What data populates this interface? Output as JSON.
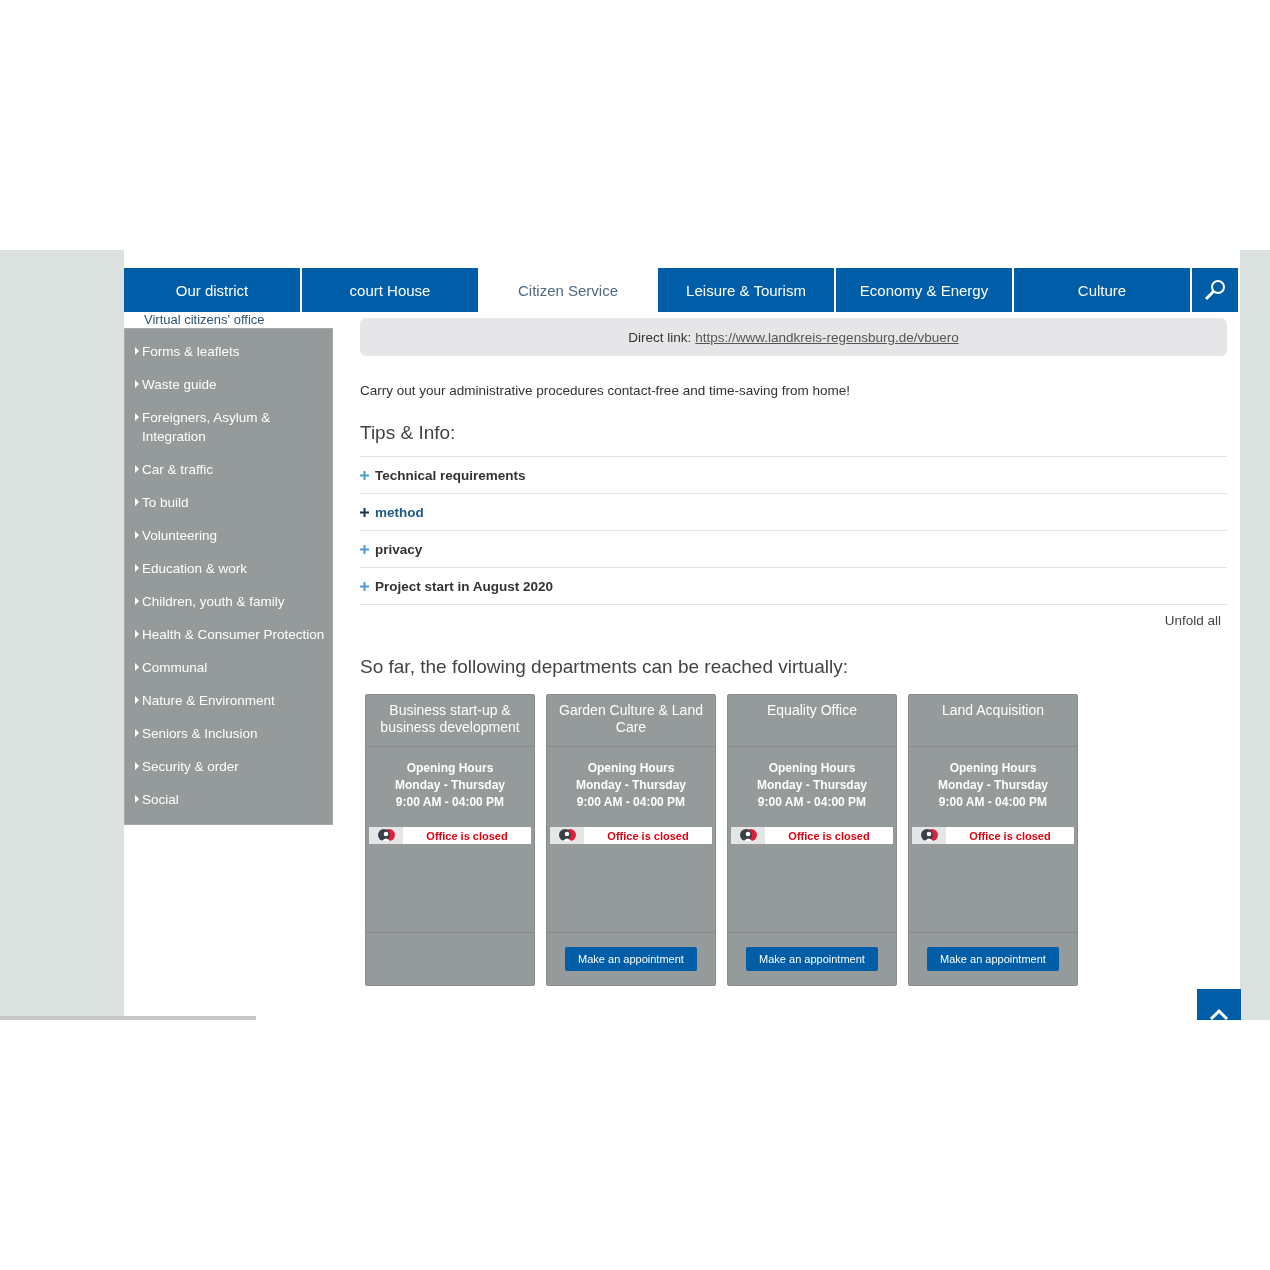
{
  "nav": {
    "tabs": [
      {
        "label": "Our district",
        "selected": false
      },
      {
        "label": "court House",
        "selected": false
      },
      {
        "label": "Citizen Service",
        "selected": true
      },
      {
        "label": "Leisure & Tourism",
        "selected": false
      },
      {
        "label": "Economy & Energy",
        "selected": false
      },
      {
        "label": "Culture",
        "selected": false
      }
    ]
  },
  "sidebar": {
    "current": "Virtual citizens' office",
    "items": [
      "Forms & leaflets",
      "Waste guide",
      "Foreigners, Asylum & Integration",
      "Car & traffic",
      "To build",
      "Volunteering",
      "Education & work",
      "Children, youth & family",
      "Health & Consumer Protection",
      "Communal",
      "Nature & Environment",
      "Seniors & Inclusion",
      "Security & order",
      "Social"
    ]
  },
  "direct_link": {
    "label": "Direct link:",
    "url": "https://www.landkreis-regensburg.de/vbuero"
  },
  "intro": "Carry out your administrative procedures contact-free and time-saving from home!",
  "tips": {
    "heading": "Tips & Info:",
    "items": [
      {
        "label": "Technical requirements",
        "highlighted": false
      },
      {
        "label": "method",
        "highlighted": true
      },
      {
        "label": "privacy",
        "highlighted": false
      },
      {
        "label": "Project start in August 2020",
        "highlighted": false
      }
    ],
    "unfold_all": "Unfold all"
  },
  "departments": {
    "heading": "So far, the following departments can be reached virtually:",
    "cards": [
      {
        "title": "Business start-up & business development",
        "hours": [
          "Opening Hours",
          "Monday - Thursday",
          "9:00 AM - 04:00 PM"
        ],
        "status": "Office is closed"
      },
      {
        "title": "Garden Culture & Land Care",
        "hours": [
          "Opening Hours",
          "Monday - Thursday",
          "9:00 AM - 04:00 PM"
        ],
        "status": "Office is closed",
        "button": "Make an appointment"
      },
      {
        "title": "Equality Office",
        "hours": [
          "Opening Hours",
          "Monday - Thursday",
          "9:00 AM - 04:00 PM"
        ],
        "status": "Office is closed",
        "button": "Make an appointment"
      },
      {
        "title": "Land Acquisition",
        "hours": [
          "Opening Hours",
          "Monday - Thursday",
          "9:00 AM - 04:00 PM"
        ],
        "status": "Office is closed",
        "button": "Make an appointment"
      }
    ]
  }
}
